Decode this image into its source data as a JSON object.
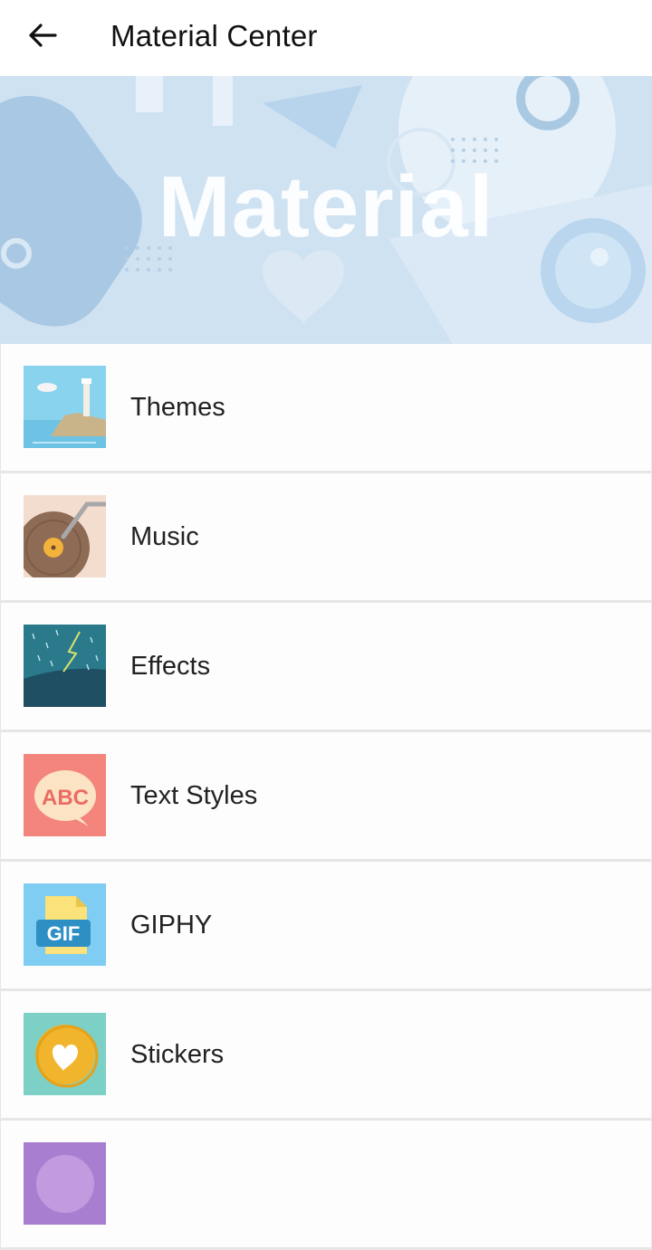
{
  "header": {
    "title": "Material Center",
    "back_icon": "arrow-left-icon"
  },
  "banner": {
    "text": "Material",
    "colors": {
      "base": "#c9def0",
      "shape": "#aecce6",
      "light": "#e3eef8"
    }
  },
  "categories": [
    {
      "label": "Themes",
      "icon": "lighthouse-icon"
    },
    {
      "label": "Music",
      "icon": "vinyl-record-icon"
    },
    {
      "label": "Effects",
      "icon": "rain-lightning-icon"
    },
    {
      "label": "Text Styles",
      "icon": "abc-speech-bubble-icon",
      "icon_text": "ABC"
    },
    {
      "label": "GIPHY",
      "icon": "gif-file-icon",
      "icon_text": "GIF"
    },
    {
      "label": "Stickers",
      "icon": "heart-sticker-icon"
    },
    {
      "label": "",
      "icon": "purple-circle-icon"
    }
  ]
}
